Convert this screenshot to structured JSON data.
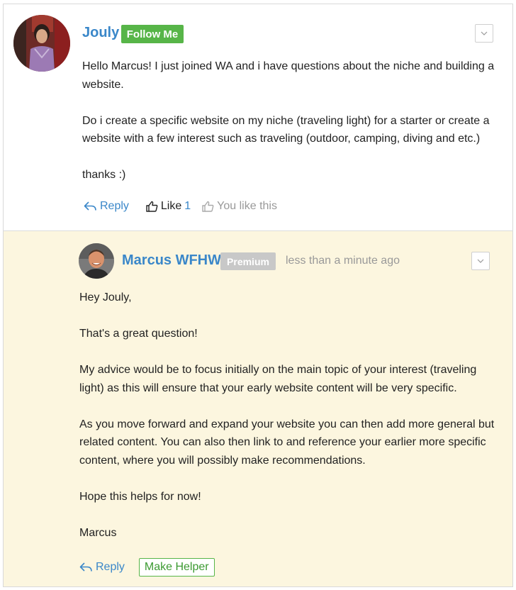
{
  "post": {
    "author": "Jouly",
    "follow_label": "Follow Me",
    "paragraphs": [
      "Hello Marcus! I just joined WA and i have questions about the niche and building a website.",
      "Do i create a specific website on my niche (traveling light) for a starter or create a website with a few interest such as traveling (outdoor, camping, diving and etc.)",
      "thanks :)"
    ],
    "reply_label": "Reply",
    "like_label": "Like",
    "like_count": "1",
    "you_like_label": "You like this"
  },
  "reply": {
    "author": "Marcus WFHW",
    "badge": "Premium",
    "timestamp": "less than a minute ago",
    "paragraphs": [
      "Hey Jouly,",
      "That's a great question!",
      "My advice would be to focus initially on the main topic of your interest (traveling light) as this will ensure that your early website content will be very specific.",
      "As you move forward and expand your website you can then add more general but related content. You can also then link to and reference your earlier more specific content, where you will possibly make recommendations.",
      "Hope this helps for now!",
      "Marcus"
    ],
    "reply_label": "Reply",
    "helper_label": "Make Helper"
  },
  "colors": {
    "link_blue": "#3a87c9",
    "follow_green": "#57b548",
    "premium_gray": "#c8c8c8",
    "reply_background": "#fcf6df"
  },
  "icons": {
    "dropdown": "chevron-down-icon",
    "reply": "reply-arrow-icon",
    "like": "thumbs-up-icon"
  }
}
